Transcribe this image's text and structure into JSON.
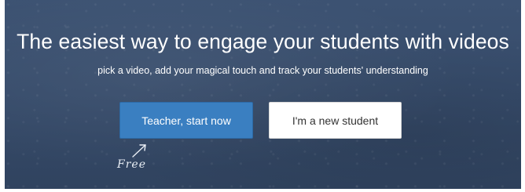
{
  "hero": {
    "headline": "The easiest way to engage your students with videos",
    "subline": "pick a video, add your magical touch and track your students' understanding"
  },
  "buttons": {
    "teacher_label": "Teacher, start now",
    "student_label": "I'm a new student"
  },
  "note": {
    "free_text": "Free",
    "arrow_icon": "chalk-arrow-up-right"
  },
  "colors": {
    "background": "#364b6a",
    "primary_button": "#3a7fc1",
    "secondary_button": "#ffffff"
  }
}
